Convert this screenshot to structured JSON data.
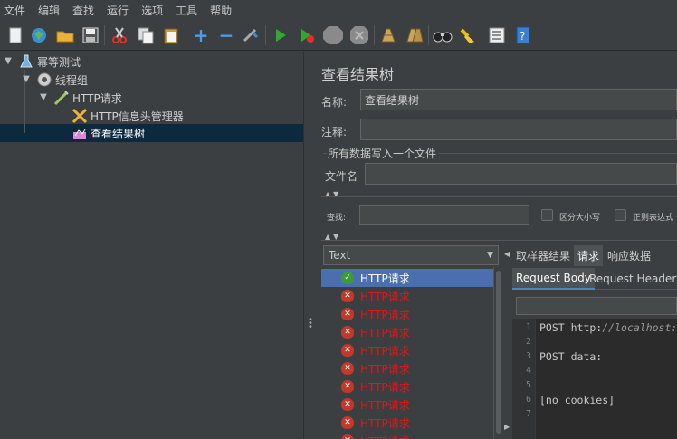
{
  "menu": [
    "文件",
    "编辑",
    "查找",
    "运行",
    "选项",
    "工具",
    "帮助"
  ],
  "toolbar_icons": [
    "new-icon",
    "templates-icon",
    "open-icon",
    "save-icon",
    "cut-icon",
    "copy-icon",
    "paste-icon",
    "expand-icon",
    "collapse-icon",
    "toggle-icon",
    "start-icon",
    "start-no-pause-icon",
    "stop-icon",
    "shutdown-icon",
    "clear-icon",
    "clear-all-icon",
    "search-icon",
    "reset-search-icon",
    "function-helper-icon",
    "help-icon"
  ],
  "tree": {
    "items": [
      {
        "label": "幂等测试",
        "icon": "test-plan-icon"
      },
      {
        "label": "线程组",
        "icon": "thread-group-icon"
      },
      {
        "label": "HTTP请求",
        "icon": "http-sampler-icon"
      },
      {
        "label": "HTTP信息头管理器",
        "icon": "header-manager-icon"
      },
      {
        "label": "查看结果树",
        "icon": "result-tree-icon"
      }
    ]
  },
  "panel": {
    "title": "查看结果树",
    "name_label": "名称:",
    "name_value": "查看结果树",
    "comment_label": "注释:",
    "comment_value": "",
    "write_all_label": "所有数据写入一个文件",
    "filename_label": "文件名",
    "filename_value": "",
    "search_label": "查找:",
    "search_value": "",
    "case_sensitive_label": "区分大小写",
    "regex_label": "正则表达式"
  },
  "results": {
    "renderer": "Text",
    "rows": [
      {
        "label": "HTTP请求",
        "status": "success"
      },
      {
        "label": "HTTP请求",
        "status": "error"
      },
      {
        "label": "HTTP请求",
        "status": "error"
      },
      {
        "label": "HTTP请求",
        "status": "error"
      },
      {
        "label": "HTTP请求",
        "status": "error"
      },
      {
        "label": "HTTP请求",
        "status": "error"
      },
      {
        "label": "HTTP请求",
        "status": "error"
      },
      {
        "label": "HTTP请求",
        "status": "error"
      },
      {
        "label": "HTTP请求",
        "status": "error"
      },
      {
        "label": "HTTP请求",
        "status": "error"
      }
    ]
  },
  "tabs": [
    "取样器结果",
    "请求",
    "响应数据"
  ],
  "active_tab": "请求",
  "subtabs": [
    "Request Body",
    "Request Headers"
  ],
  "active_subtab": "Request Body",
  "editor": {
    "lines": [
      {
        "n": "1",
        "text": "POST http:",
        "italic": "//localhost:"
      },
      {
        "n": "2",
        "text": "",
        "italic": ""
      },
      {
        "n": "3",
        "text": "POST data:",
        "italic": ""
      },
      {
        "n": "4",
        "text": "",
        "italic": ""
      },
      {
        "n": "5",
        "text": "",
        "italic": ""
      },
      {
        "n": "6",
        "text": "[no cookies]",
        "italic": ""
      },
      {
        "n": "7",
        "text": "",
        "italic": ""
      }
    ]
  },
  "colors": {
    "selection": "#4b6eaf",
    "error_text": "#e81414",
    "success_icon": "#3c9a3c",
    "error_icon": "#c0392b"
  }
}
